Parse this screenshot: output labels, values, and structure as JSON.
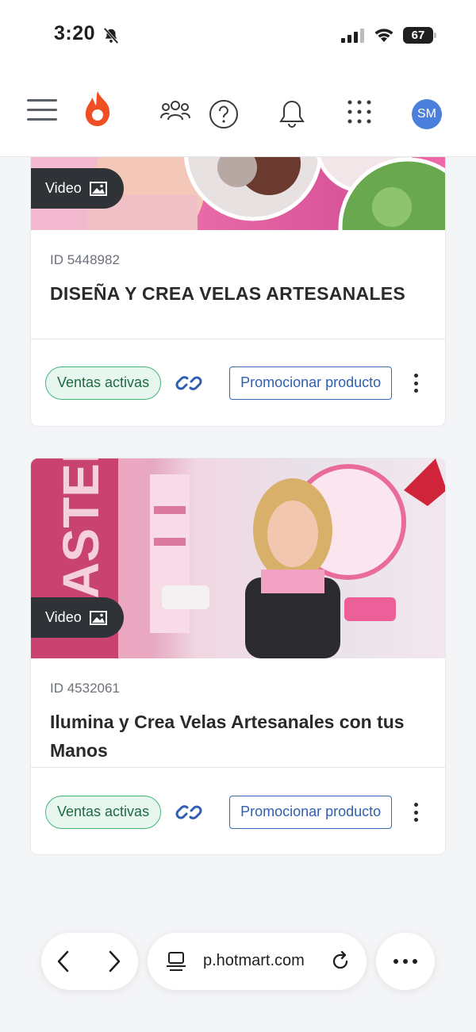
{
  "status_bar": {
    "time": "3:20",
    "battery": "67"
  },
  "header": {
    "avatar_initials": "SM"
  },
  "products": [
    {
      "media_badge": "Video",
      "id_label": "ID 5448982",
      "title": "DISEÑA Y CREA VELAS ARTESANALES",
      "status": "Ventas activas",
      "promote_label": "Promocionar producto"
    },
    {
      "media_badge": "Video",
      "id_label": "ID 4532061",
      "title": "Ilumina y Crea Velas Artesanales con tus Manos",
      "status": "Ventas activas",
      "promote_label": "Promocionar producto"
    }
  ],
  "browser": {
    "url": "p.hotmart.com"
  },
  "colors": {
    "brand": "#f04e23",
    "avatar": "#4a80dc",
    "status_green": "#3fb57a",
    "promo_blue": "#3a68b8"
  }
}
